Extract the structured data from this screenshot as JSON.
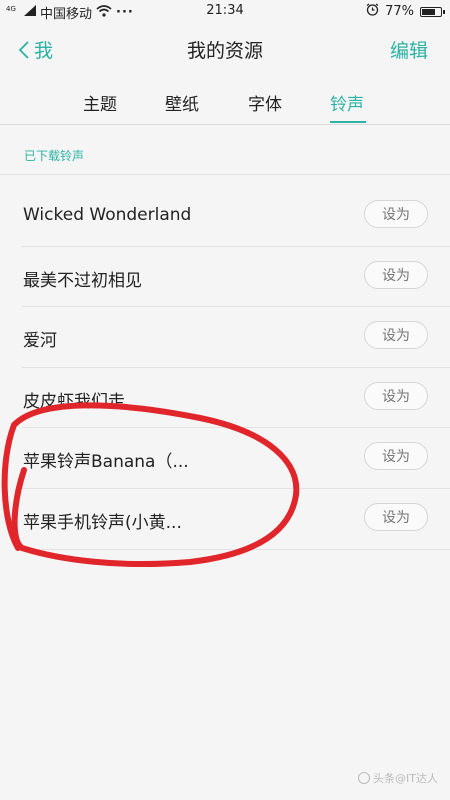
{
  "status_bar": {
    "network_label": "4G",
    "carrier": "中国移动",
    "time": "21:34",
    "battery_text": "77%",
    "battery_level": 0.77
  },
  "nav": {
    "back_label": "我",
    "title": "我的资源",
    "edit_label": "编辑"
  },
  "tabs": [
    {
      "label": "主题",
      "active": false
    },
    {
      "label": "壁纸",
      "active": false
    },
    {
      "label": "字体",
      "active": false
    },
    {
      "label": "铃声",
      "active": true
    }
  ],
  "section": {
    "header": "已下载铃声"
  },
  "ringtones": [
    {
      "title": "Wicked Wonderland",
      "action": "设为"
    },
    {
      "title": "最美不过初相见",
      "action": "设为"
    },
    {
      "title": "爱河",
      "action": "设为"
    },
    {
      "title": "皮皮虾我们走",
      "action": "设为"
    },
    {
      "title": "苹果铃声Banana（...",
      "action": "设为"
    },
    {
      "title": "苹果手机铃声(小黄...",
      "action": "设为"
    }
  ],
  "colors": {
    "accent": "#2bb3a3",
    "annotation": "#e0262b"
  },
  "watermark": {
    "text": "头条@IT达人"
  }
}
